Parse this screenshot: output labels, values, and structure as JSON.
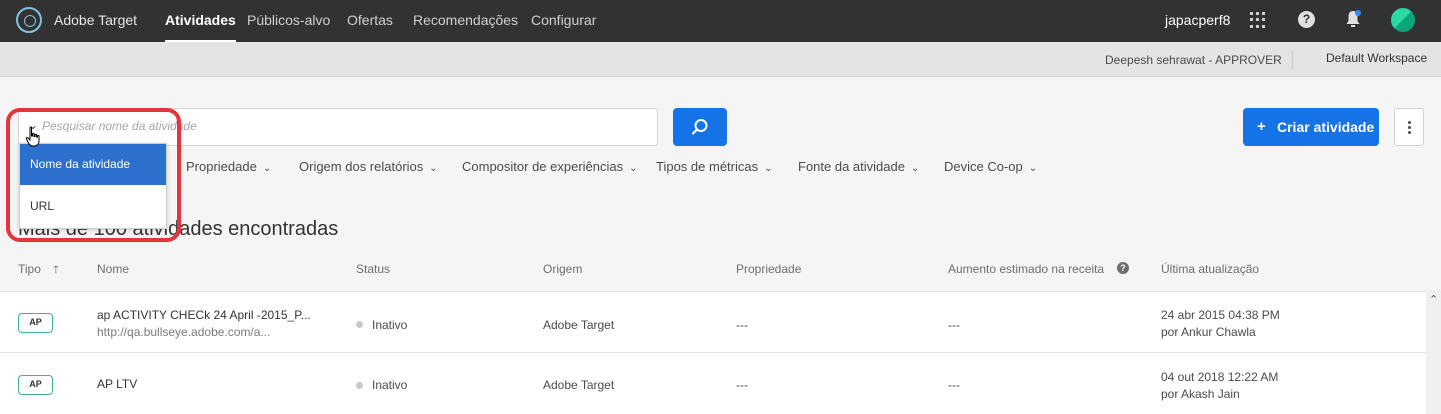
{
  "topbar": {
    "brand": "Adobe Target",
    "nav": [
      "Atividades",
      "Públicos-alvo",
      "Ofertas",
      "Recomendações",
      "Configurar"
    ],
    "tenant": "japacperf8"
  },
  "subbar": {
    "user_role": "Deepesh sehrawat - APPROVER",
    "workspace": "Default Workspace"
  },
  "search": {
    "placeholder": "Pesquisar nome da atividade",
    "dropdown_options": [
      "Nome da atividade",
      "URL"
    ]
  },
  "actions": {
    "create_label": "Criar atividade",
    "create_plus": "+"
  },
  "filters": [
    "Propriedade",
    "Origem dos relatórios",
    "Compositor de experiências",
    "Tipos de métricas",
    "Fonte da atividade",
    "Device Co-op"
  ],
  "results": {
    "title": "Mais de 100 atividades encontradas"
  },
  "table": {
    "headers": [
      "Tipo",
      "Nome",
      "Status",
      "Origem",
      "Propriedade",
      "Aumento estimado na receita",
      "Última atualização"
    ],
    "rows": [
      {
        "type": "AP",
        "name": "ap  ACTIVITY CHECk 24 April -2015_P...",
        "url": "http://qa.bullseye.adobe.com/a...",
        "status": "Inativo",
        "origin": "Adobe Target",
        "property": "---",
        "lift": "---",
        "updated_date": "24 abr 2015 04:38 PM",
        "updated_by": "por Ankur Chawla"
      },
      {
        "type": "AP",
        "name": "AP LTV",
        "url": "",
        "status": "Inativo",
        "origin": "Adobe Target",
        "property": "---",
        "lift": "---",
        "updated_date": "04 out 2018 12:22 AM",
        "updated_by": "por Akash Jain"
      }
    ]
  },
  "colors": {
    "accent": "#1473e6",
    "topbar": "#323232",
    "highlight": "#e5353b",
    "badge_border": "#3fb39b"
  }
}
